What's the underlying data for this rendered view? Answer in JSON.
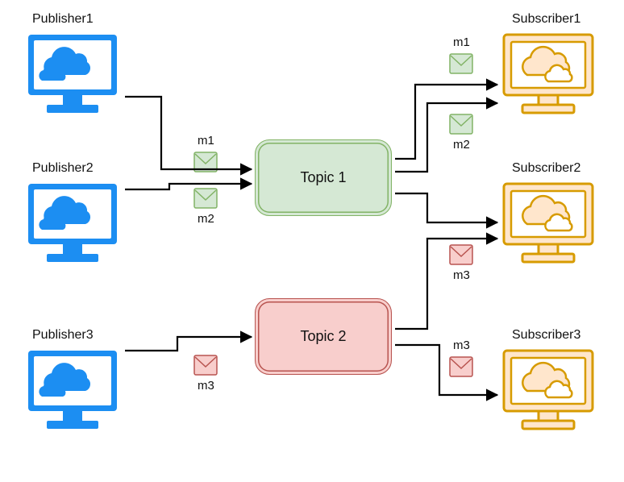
{
  "publishers": [
    {
      "label": "Publisher1"
    },
    {
      "label": "Publisher2"
    },
    {
      "label": "Publisher3"
    }
  ],
  "subscribers": [
    {
      "label": "Subscriber1"
    },
    {
      "label": "Subscriber2"
    },
    {
      "label": "Subscriber3"
    }
  ],
  "topics": [
    {
      "label": "Topic 1",
      "color": "green"
    },
    {
      "label": "Topic 2",
      "color": "red"
    }
  ],
  "messages": {
    "pub_to_topic1": [
      {
        "label": "m1",
        "color": "green"
      },
      {
        "label": "m2",
        "color": "green"
      }
    ],
    "pub_to_topic2": [
      {
        "label": "m3",
        "color": "red"
      }
    ],
    "topic1_to_sub1": [
      {
        "label": "m1",
        "color": "green"
      },
      {
        "label": "m2",
        "color": "green"
      }
    ],
    "topic2_to_sub2": [
      {
        "label": "m3",
        "color": "red"
      }
    ],
    "topic2_to_sub3": [
      {
        "label": "m3",
        "color": "red"
      }
    ]
  },
  "colors": {
    "publisher": "#1c8ef2",
    "subscriber_stroke": "#d79b00",
    "subscriber_fill": "#ffe6cc",
    "green_stroke": "#82b366",
    "green_fill": "#d5e8d4",
    "red_stroke": "#b85450",
    "red_fill": "#f8cecc",
    "arrow": "#000000"
  }
}
